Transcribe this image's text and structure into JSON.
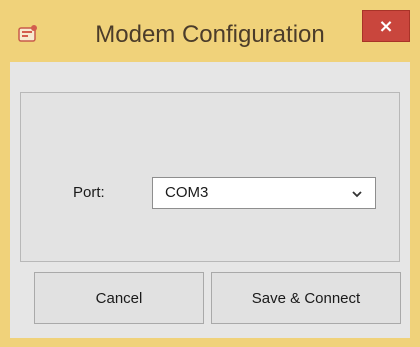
{
  "window": {
    "title": "Modem Configuration",
    "close_label": "×",
    "app_icon": "app-icon",
    "titlebar_color": "#f0d27a",
    "close_color": "#c9463d"
  },
  "form": {
    "port_label": "Port:",
    "port_value": "COM3"
  },
  "buttons": {
    "cancel_label": "Cancel",
    "save_label": "Save & Connect"
  }
}
